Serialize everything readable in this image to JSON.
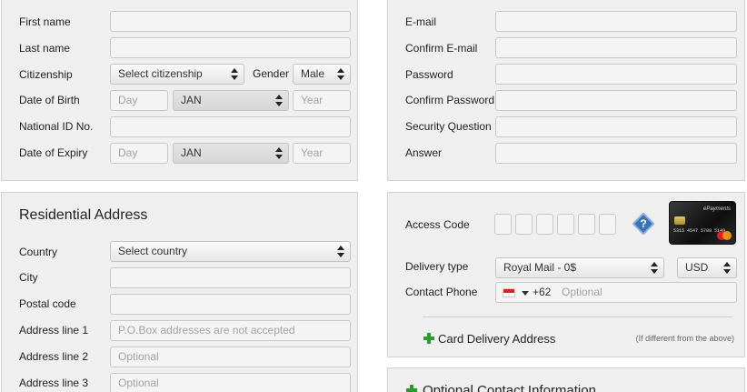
{
  "personal": {
    "first_name": "First name",
    "last_name": "Last name",
    "citizenship": "Citizenship",
    "citizenship_select": "Select citizenship",
    "gender": "Gender",
    "gender_value": "Male",
    "dob": "Date of Birth",
    "dob_day": "Day",
    "dob_month": "JAN",
    "dob_year": "Year",
    "national_id": "National ID No.",
    "expiry": "Date of Expiry",
    "exp_day": "Day",
    "exp_month": "JAN",
    "exp_year": "Year"
  },
  "account": {
    "email": "E-mail",
    "confirm_email": "Confirm E-mail",
    "password": "Password",
    "confirm_password": "Confirm Password",
    "security_question": "Security Question",
    "answer": "Answer"
  },
  "address": {
    "title": "Residential Address",
    "country": "Country",
    "country_select": "Select country",
    "city": "City",
    "postal": "Postal code",
    "line1": "Address line 1",
    "line1_placeholder": "P.O.Box addresses are not accepted",
    "line2": "Address line 2",
    "line2_placeholder": "Optional",
    "line3": "Address line 3",
    "line3_placeholder": "Optional"
  },
  "delivery": {
    "access_code": "Access Code",
    "help_symbol": "?",
    "delivery_type": "Delivery type",
    "delivery_value": "Royal Mail - 0$",
    "currency": "USD",
    "contact_phone": "Contact Phone",
    "phone_prefix": "+62",
    "phone_placeholder": "Optional",
    "card_delivery": "Card Delivery Address",
    "card_delivery_note": "(If different from the above)"
  },
  "card": {
    "number": "5315 4547 5700 5149",
    "brand": "ePayments"
  },
  "optional": {
    "title": "Optional Contact Information"
  },
  "colors": {
    "panel": "#efefef",
    "accent_green": "#2e9a2e",
    "help_blue": "#3a73b8"
  }
}
